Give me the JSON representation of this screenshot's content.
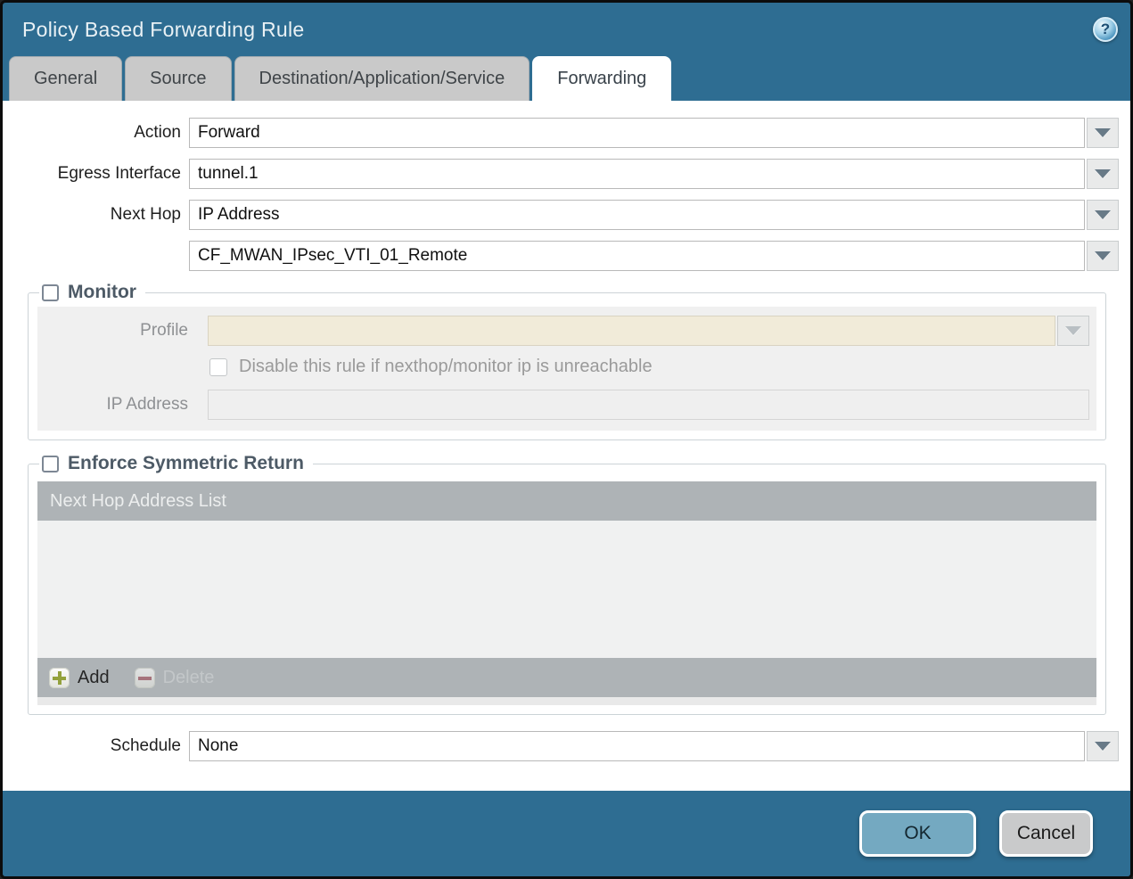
{
  "dialog": {
    "title": "Policy Based Forwarding Rule",
    "help_glyph": "?"
  },
  "tabs": [
    {
      "label": "General",
      "active": false
    },
    {
      "label": "Source",
      "active": false
    },
    {
      "label": "Destination/Application/Service",
      "active": false
    },
    {
      "label": "Forwarding",
      "active": true
    }
  ],
  "form": {
    "action": {
      "label": "Action",
      "value": "Forward"
    },
    "egress_interface": {
      "label": "Egress Interface",
      "value": "tunnel.1"
    },
    "next_hop": {
      "label": "Next Hop",
      "value": "IP Address"
    },
    "next_hop_address": {
      "value": "CF_MWAN_IPsec_VTI_01_Remote"
    },
    "schedule": {
      "label": "Schedule",
      "value": "None"
    }
  },
  "monitor": {
    "title": "Monitor",
    "checked": false,
    "profile": {
      "label": "Profile",
      "value": ""
    },
    "disable_rule": {
      "label": "Disable this rule if nexthop/monitor ip is unreachable",
      "checked": false
    },
    "ip_address": {
      "label": "IP Address",
      "value": ""
    }
  },
  "enforce_symmetric_return": {
    "title": "Enforce Symmetric Return",
    "checked": false,
    "table": {
      "header": "Next Hop Address List",
      "rows": [],
      "add_label": "Add",
      "delete_label": "Delete"
    }
  },
  "footer": {
    "ok_label": "OK",
    "cancel_label": "Cancel"
  },
  "icons": {
    "help": "question-mark-circle",
    "dropdown": "chevron-down-triangle",
    "add": "green-plus-square",
    "delete": "red-minus-square"
  },
  "colors": {
    "titlebar_teal": "#2e6d92",
    "tab_inactive": "#c9c9c9",
    "tab_text": "#3f4448",
    "field_border": "#b9b9b9",
    "dropdown_btn_bg": "#e9eaea",
    "dropdown_arrow": "#687a87",
    "section_label": "#4d5a66",
    "panel_bg": "#f0f0f0",
    "profile_field_bg": "#f1ebd9",
    "disabled_text": "#9a9a9a",
    "table_bar": "#aeb3b6",
    "table_body": "#f0f1f1",
    "add_plus": "#93a13c",
    "delete_minus": "#a1525c",
    "ok_button": "#74a9c1",
    "cancel_button": "#c9cacb"
  }
}
